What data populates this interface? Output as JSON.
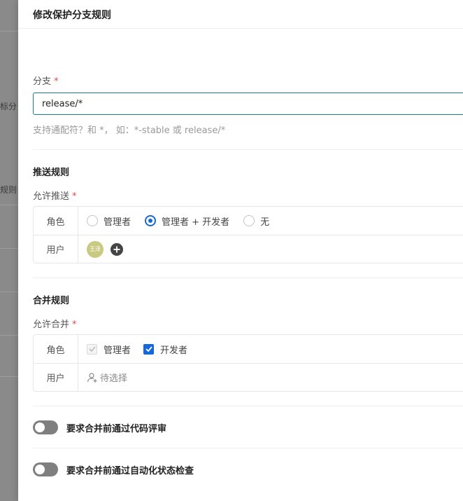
{
  "background": {
    "text_1": "标分",
    "text_2": "规则"
  },
  "drawer": {
    "title": "修改保护分支规则"
  },
  "branch": {
    "label": "分支",
    "required_mark": "*",
    "value": "release/*",
    "hint": "支持通配符？和 *， 如：*-stable 或 release/*"
  },
  "push_rules": {
    "title": "推送规则",
    "allow_label": "允许推送",
    "required_mark": "*",
    "role_key": "角色",
    "user_key": "用户",
    "roles": [
      {
        "label": "管理者",
        "selected": false
      },
      {
        "label": "管理者 + 开发者",
        "selected": true
      },
      {
        "label": "无",
        "selected": false
      }
    ],
    "users": [
      {
        "avatar_text": "王泽"
      }
    ]
  },
  "merge_rules": {
    "title": "合并规则",
    "allow_label": "允许合并",
    "required_mark": "*",
    "role_key": "角色",
    "user_key": "用户",
    "roles": [
      {
        "label": "管理者",
        "checked": true,
        "disabled": true
      },
      {
        "label": "开发者",
        "checked": true,
        "disabled": false
      }
    ],
    "users_placeholder": "待选择"
  },
  "toggles": [
    {
      "label": "要求合并前通过代码评审",
      "on": false
    },
    {
      "label": "要求合并前通过自动化状态检查",
      "on": false
    }
  ],
  "colors": {
    "accent": "#1468d9",
    "input_border": "#1e7a8c",
    "required": "#e5484d",
    "toggle_off": "#7f7f7f"
  }
}
